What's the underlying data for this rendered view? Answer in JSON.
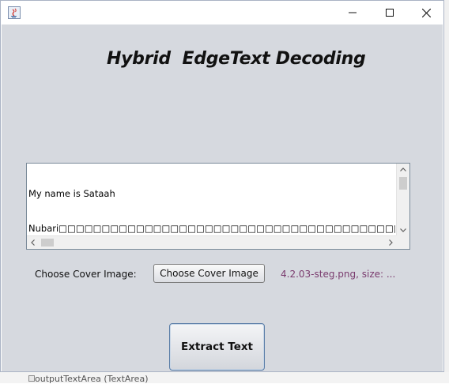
{
  "window": {
    "title": "",
    "controls": [
      "minimize",
      "maximize",
      "close"
    ]
  },
  "heading": "Hybrid  EdgeText Decoding",
  "decoded_text": {
    "lines": [
      "My name is Sataah",
      "Nubari□□□□□□□□□□□□□□□□□□□□□□□□□□□□□□□□□□□□□□□□□□□□□□□□□□□",
      "□□□□□□□□□□□□□□□□□□□□□□□□□□□□□□□□□□□□□□□□□□□□□□□□□□□□□□□□",
      "□□□□□□□□□□□□□□□□□□□□□□□□□□□□□□□□□□□□□□□□□□□□□□□□□□□□□□□□",
      "□□□□□□□□□□□□□□□□□□□□□□□□□□□□□□□□□□□□□□□□□□□□□□□□□□□□□□□□",
      "□□□□□□□□□□□□□□□□□□□□□□□□□□□□□□□□□□□□□□□□□□□□□□□□□□□□□□□□"
    ]
  },
  "cover": {
    "label": "Choose Cover Image:",
    "button_label": "Choose Cover Image",
    "file_status": "4.2.03-steg.png, size: ..."
  },
  "extract_button_label": "Extract Text",
  "background": {
    "bottom_text": "outputTextArea (TextArea)"
  },
  "colors": {
    "client_bg": "#d6d9df",
    "file_status": "#7a3b6e",
    "extract_border": "#5b7ea8"
  }
}
